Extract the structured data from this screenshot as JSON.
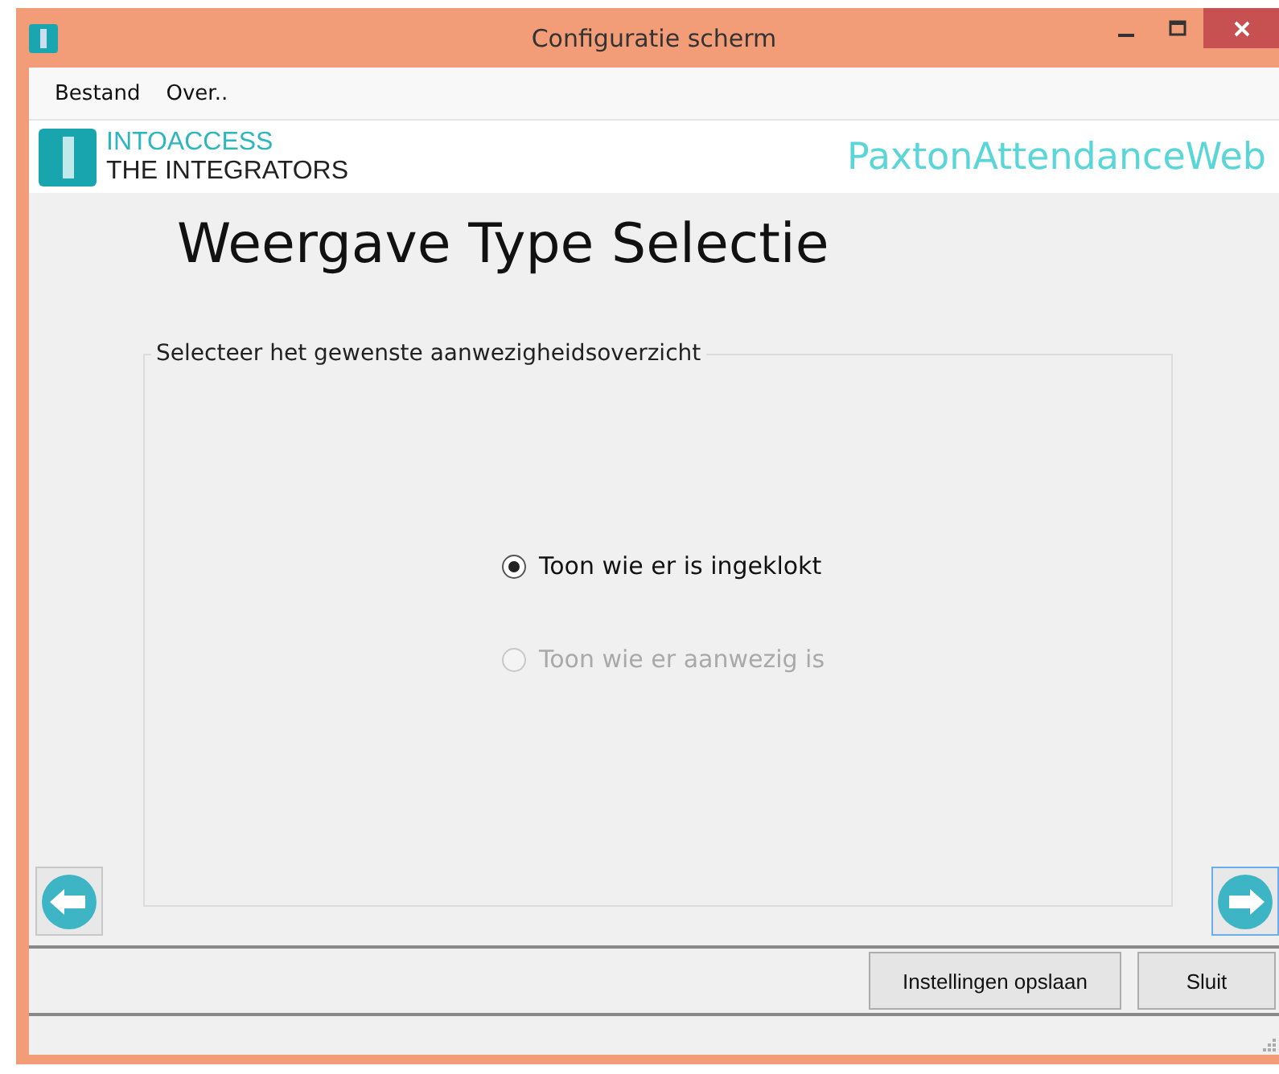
{
  "window": {
    "title": "Configuratie scherm"
  },
  "menu": [
    "Bestand",
    "Over.."
  ],
  "logo": {
    "brand": "INTOACCESS",
    "tagline": "THE INTEGRATORS"
  },
  "app_name": "PaxtonAttendanceWeb",
  "heading": "Weergave Type Selectie",
  "group": {
    "legend": "Selecteer het gewenste aanwezigheidsoverzicht",
    "options": [
      {
        "label": "Toon wie er is ingeklokt",
        "selected": true,
        "disabled": false
      },
      {
        "label": "Toon wie er aanwezig is",
        "selected": false,
        "disabled": true
      }
    ]
  },
  "buttons": [
    "Instellingen opslaan",
    "Sluit"
  ]
}
